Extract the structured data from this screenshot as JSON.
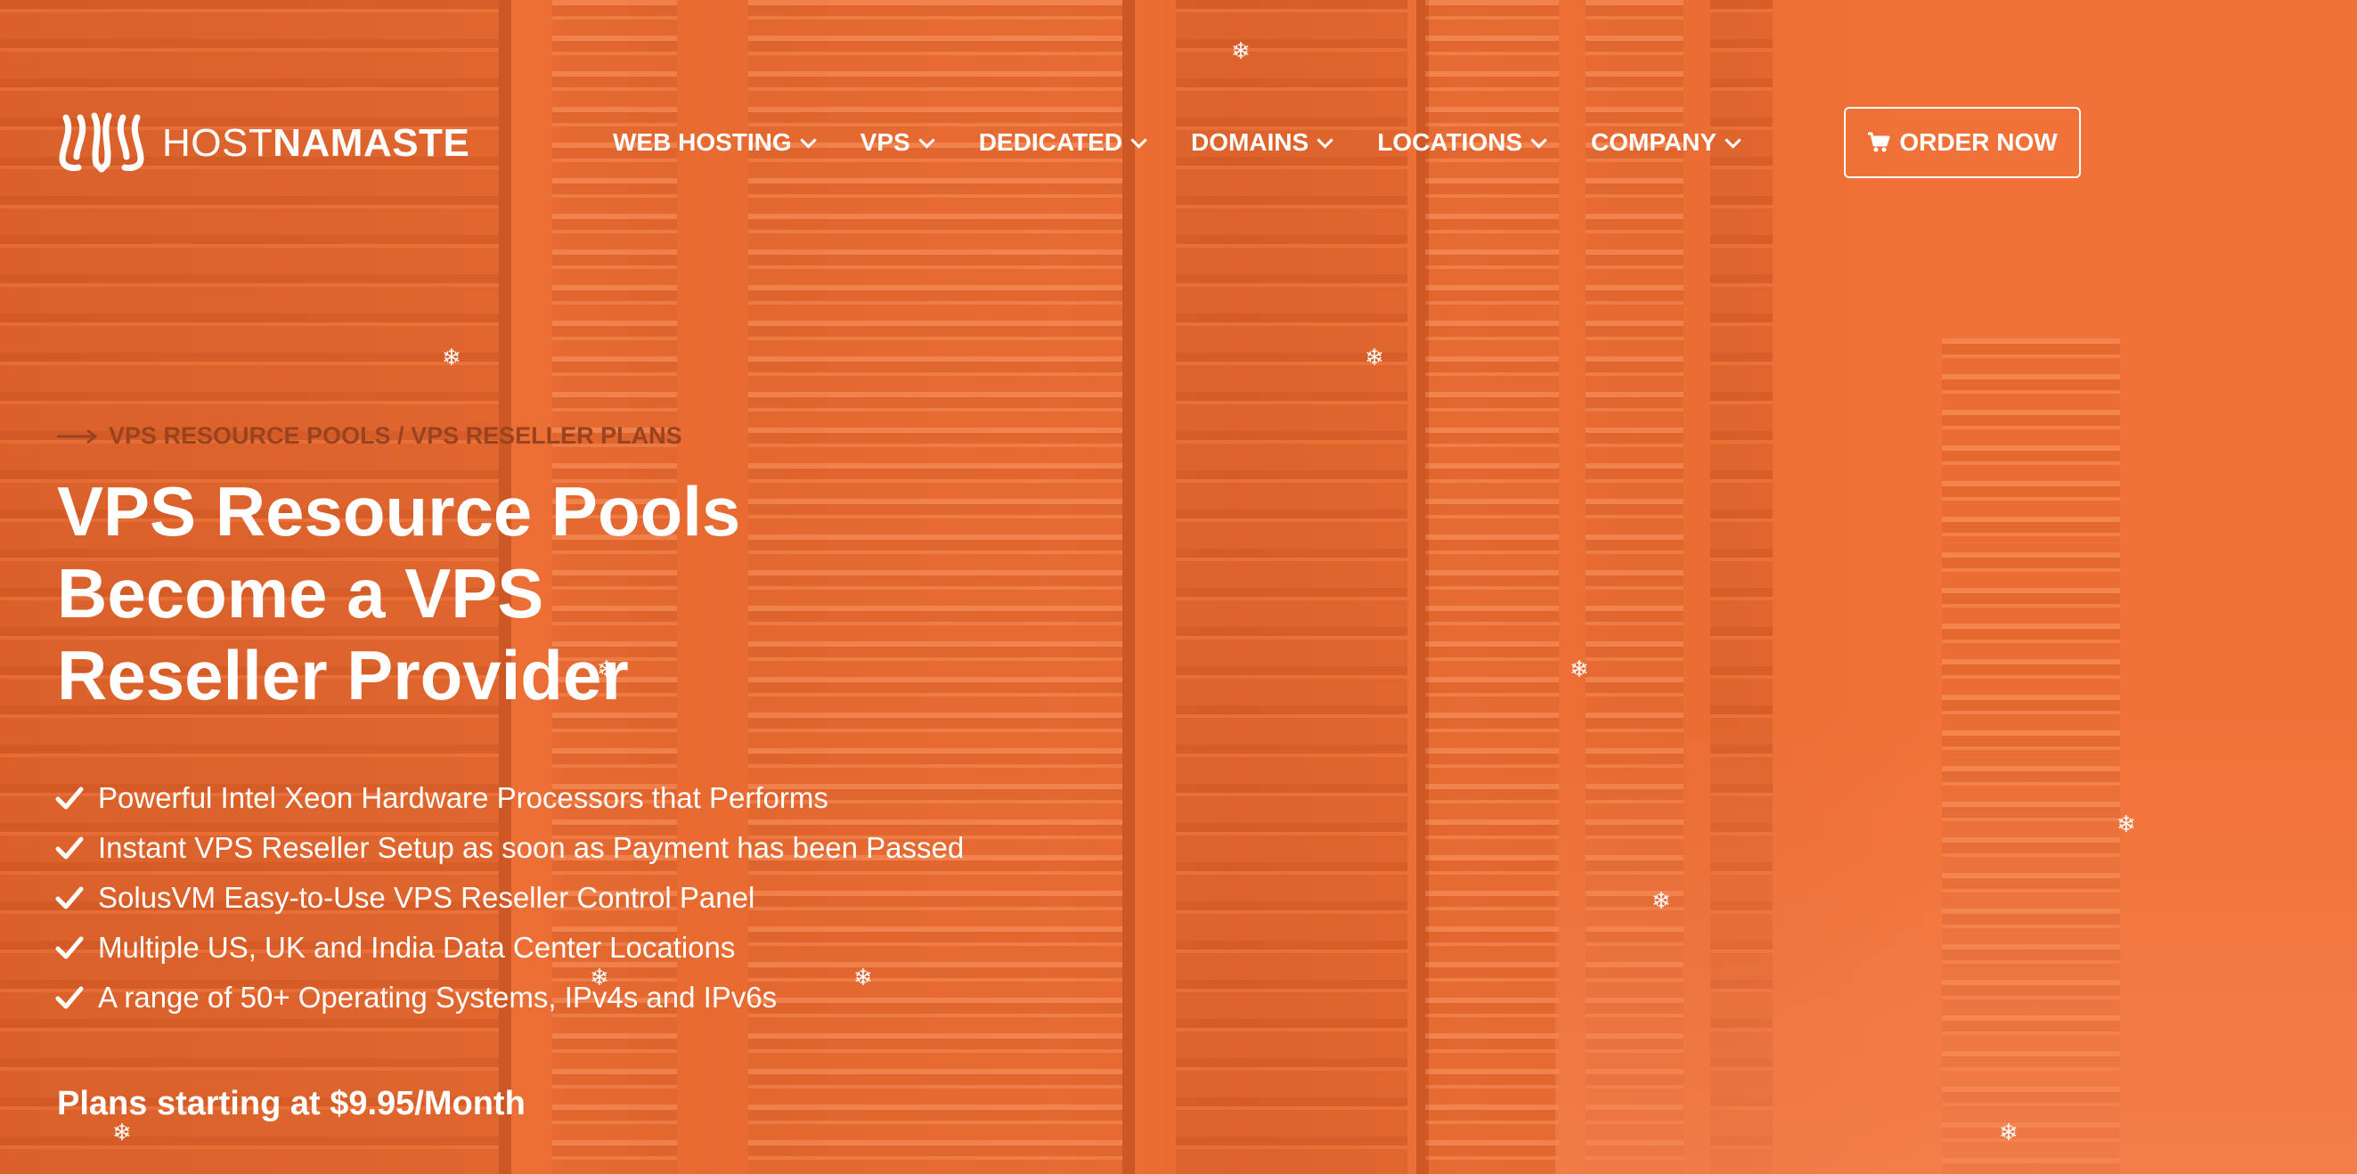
{
  "brand": {
    "name_light": "HOST",
    "name_bold": "NAMASTE",
    "logo_icon": "namaste-hands-icon"
  },
  "nav": {
    "items": [
      {
        "label": "WEB HOSTING"
      },
      {
        "label": "VPS"
      },
      {
        "label": "DEDICATED"
      },
      {
        "label": "DOMAINS"
      },
      {
        "label": "LOCATIONS"
      },
      {
        "label": "COMPANY"
      }
    ],
    "order_button": {
      "label": "ORDER NOW",
      "icon": "cart-icon"
    }
  },
  "breadcrumb": {
    "arrow_icon": "arrow-right-icon",
    "part1": "VPS RESOURCE POOLS",
    "separator": " / ",
    "part2": "VPS RESELLER PLANS"
  },
  "hero": {
    "title_lines": [
      "VPS Resource Pools",
      "Become a VPS",
      "Reseller Provider"
    ],
    "features": [
      "Powerful Intel Xeon Hardware Processors that Performs",
      "Instant VPS Reseller Setup as soon as Payment has been Passed",
      "SolusVM Easy-to-Use VPS Reseller Control Panel",
      "Multiple US, UK and India Data Center Locations",
      "A range of 50+ Operating Systems, IPv4s and IPv6s"
    ],
    "pricing": "Plans starting at $9.95/Month"
  },
  "decor": {
    "snowflake_glyph": "❄"
  },
  "colors": {
    "accent": "#f0763e",
    "breadcrumb": "#9a4320",
    "text": "#ffffff"
  }
}
